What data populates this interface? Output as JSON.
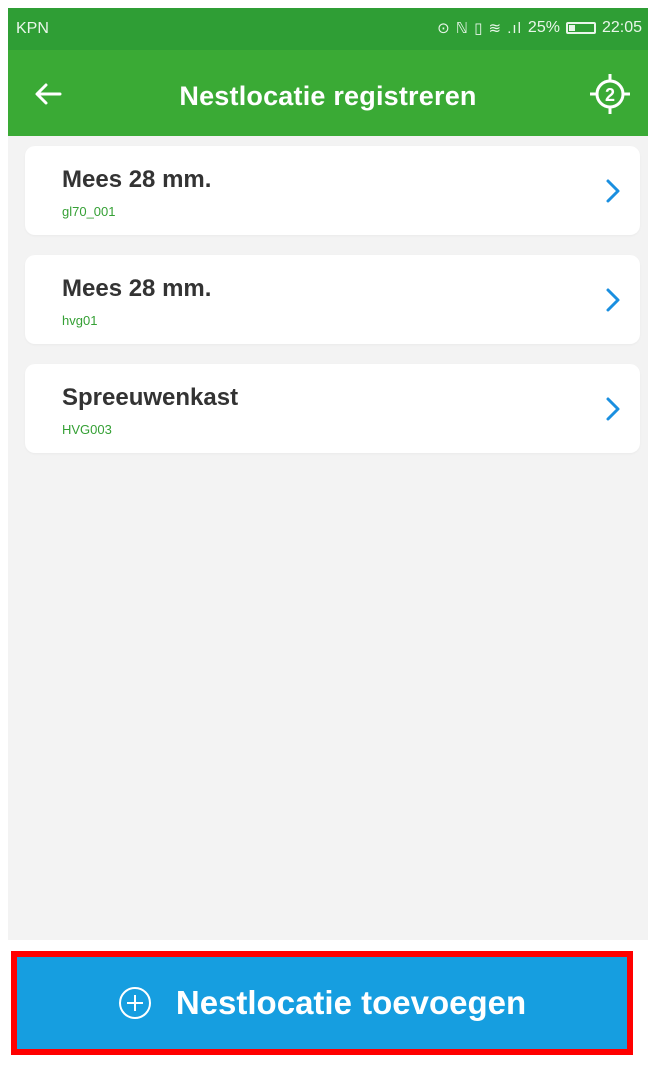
{
  "status_bar": {
    "carrier": "KPN",
    "icons": "⊙ ℕ ▯ ≋ .ıl",
    "battery": "25%",
    "time": "22:05"
  },
  "app_bar": {
    "title": "Nestlocatie registreren",
    "gps_badge": "2"
  },
  "locations": [
    {
      "name": "Mees 28 mm.",
      "code": "gl70_001"
    },
    {
      "name": "Mees 28 mm.",
      "code": "hvg01"
    },
    {
      "name": "Spreeuwenkast",
      "code": "HVG003"
    }
  ],
  "add_button": {
    "label": "Nestlocatie toevoegen",
    "icon": "plus-circle-icon"
  },
  "colors": {
    "status_bar": "#2f9e35",
    "app_bar": "#3aaa35",
    "code_text": "#35a035",
    "chevron": "#1a8fe0",
    "button": "#169ee0",
    "highlight": "#ff0000"
  }
}
